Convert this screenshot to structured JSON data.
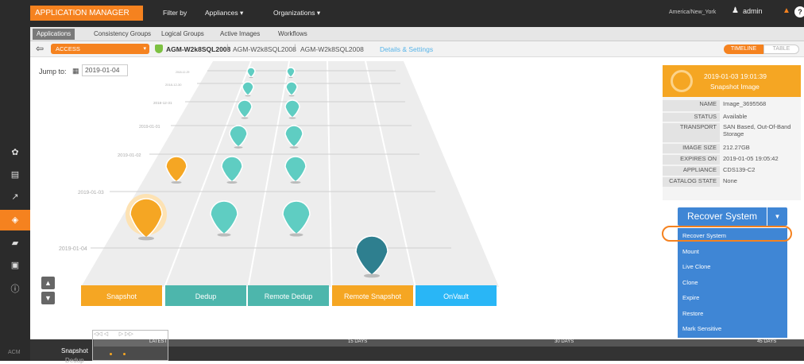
{
  "header": {
    "app_name": "APPLICATION MANAGER",
    "filter_by": "Filter by",
    "appliances": "Appliances",
    "organizations": "Organizations",
    "timezone": "America/New_York",
    "user": "admin"
  },
  "tabs": [
    "Applications",
    "Consistency Groups",
    "Logical Groups",
    "Active Images",
    "Workflows"
  ],
  "context": {
    "access_label": "ACCESS",
    "app": "AGM-W2k8SQL2008",
    "host1": "AGM-W2k8SQL2008",
    "host2": "AGM-W2k8SQL2008",
    "details": "Details & Settings",
    "timeline": "TIMELINE",
    "table": "TABLE"
  },
  "jump": {
    "label": "Jump to:",
    "date": "2019-01-04"
  },
  "timeline": {
    "row_labels": [
      "2019-01-04",
      "2019-01-03",
      "2019-01-02",
      "2019-01-01",
      "2018-12-31",
      "2018-12-30",
      "2018-12-29"
    ],
    "lanes": [
      "Snapshot",
      "Dedup",
      "Remote Dedup",
      "Remote Snapshot",
      "OnVault"
    ],
    "lane_colors": [
      "#f5a623",
      "#4db6ac",
      "#4db6ac",
      "#f5a623",
      "#29b6f6"
    ]
  },
  "panel": {
    "datetime": "2019-01-03 19:01:39",
    "type": "Snapshot Image",
    "rows": [
      {
        "label": "NAME",
        "value": "Image_3695568"
      },
      {
        "label": "STATUS",
        "value": "Available"
      },
      {
        "label": "TRANSPORT",
        "value": "SAN Based, Out-Of-Band Storage"
      },
      {
        "label": "IMAGE SIZE",
        "value": "212.27GB"
      },
      {
        "label": "EXPIRES ON",
        "value": "2019-01-05 19:05:42"
      },
      {
        "label": "APPLIANCE",
        "value": "CDS139-C2"
      },
      {
        "label": "CATALOG STATE",
        "value": "None"
      }
    ]
  },
  "recover_button": "Recover System",
  "menu": [
    "Recover System",
    "Mount",
    "Live Clone",
    "Clone",
    "Expire",
    "Restore",
    "Mark Sensitive"
  ],
  "bottom": {
    "latest": "LATEST",
    "d15": "15 DAYS",
    "d30": "30 DAYS",
    "d45": "45 DAYS",
    "snapshot": "Snapshot",
    "dedup": "Dedup",
    "acm": "ACM"
  }
}
